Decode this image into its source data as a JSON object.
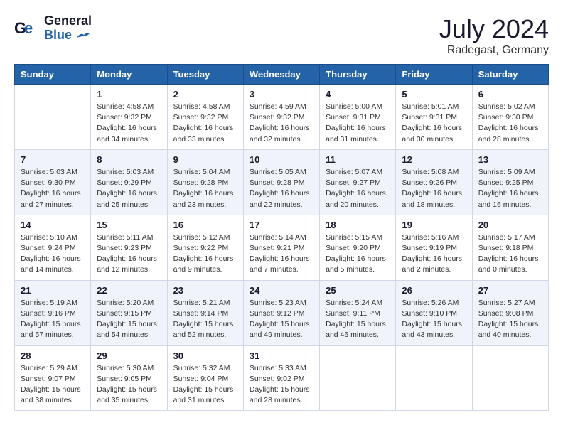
{
  "logo": {
    "general": "General",
    "blue": "Blue"
  },
  "title": "July 2024",
  "location": "Radegast, Germany",
  "days_header": [
    "Sunday",
    "Monday",
    "Tuesday",
    "Wednesday",
    "Thursday",
    "Friday",
    "Saturday"
  ],
  "weeks": [
    [
      {
        "day": "",
        "details": ""
      },
      {
        "day": "1",
        "details": "Sunrise: 4:58 AM\nSunset: 9:32 PM\nDaylight: 16 hours\nand 34 minutes."
      },
      {
        "day": "2",
        "details": "Sunrise: 4:58 AM\nSunset: 9:32 PM\nDaylight: 16 hours\nand 33 minutes."
      },
      {
        "day": "3",
        "details": "Sunrise: 4:59 AM\nSunset: 9:32 PM\nDaylight: 16 hours\nand 32 minutes."
      },
      {
        "day": "4",
        "details": "Sunrise: 5:00 AM\nSunset: 9:31 PM\nDaylight: 16 hours\nand 31 minutes."
      },
      {
        "day": "5",
        "details": "Sunrise: 5:01 AM\nSunset: 9:31 PM\nDaylight: 16 hours\nand 30 minutes."
      },
      {
        "day": "6",
        "details": "Sunrise: 5:02 AM\nSunset: 9:30 PM\nDaylight: 16 hours\nand 28 minutes."
      }
    ],
    [
      {
        "day": "7",
        "details": "Sunrise: 5:03 AM\nSunset: 9:30 PM\nDaylight: 16 hours\nand 27 minutes."
      },
      {
        "day": "8",
        "details": "Sunrise: 5:03 AM\nSunset: 9:29 PM\nDaylight: 16 hours\nand 25 minutes."
      },
      {
        "day": "9",
        "details": "Sunrise: 5:04 AM\nSunset: 9:28 PM\nDaylight: 16 hours\nand 23 minutes."
      },
      {
        "day": "10",
        "details": "Sunrise: 5:05 AM\nSunset: 9:28 PM\nDaylight: 16 hours\nand 22 minutes."
      },
      {
        "day": "11",
        "details": "Sunrise: 5:07 AM\nSunset: 9:27 PM\nDaylight: 16 hours\nand 20 minutes."
      },
      {
        "day": "12",
        "details": "Sunrise: 5:08 AM\nSunset: 9:26 PM\nDaylight: 16 hours\nand 18 minutes."
      },
      {
        "day": "13",
        "details": "Sunrise: 5:09 AM\nSunset: 9:25 PM\nDaylight: 16 hours\nand 16 minutes."
      }
    ],
    [
      {
        "day": "14",
        "details": "Sunrise: 5:10 AM\nSunset: 9:24 PM\nDaylight: 16 hours\nand 14 minutes."
      },
      {
        "day": "15",
        "details": "Sunrise: 5:11 AM\nSunset: 9:23 PM\nDaylight: 16 hours\nand 12 minutes."
      },
      {
        "day": "16",
        "details": "Sunrise: 5:12 AM\nSunset: 9:22 PM\nDaylight: 16 hours\nand 9 minutes."
      },
      {
        "day": "17",
        "details": "Sunrise: 5:14 AM\nSunset: 9:21 PM\nDaylight: 16 hours\nand 7 minutes."
      },
      {
        "day": "18",
        "details": "Sunrise: 5:15 AM\nSunset: 9:20 PM\nDaylight: 16 hours\nand 5 minutes."
      },
      {
        "day": "19",
        "details": "Sunrise: 5:16 AM\nSunset: 9:19 PM\nDaylight: 16 hours\nand 2 minutes."
      },
      {
        "day": "20",
        "details": "Sunrise: 5:17 AM\nSunset: 9:18 PM\nDaylight: 16 hours\nand 0 minutes."
      }
    ],
    [
      {
        "day": "21",
        "details": "Sunrise: 5:19 AM\nSunset: 9:16 PM\nDaylight: 15 hours\nand 57 minutes."
      },
      {
        "day": "22",
        "details": "Sunrise: 5:20 AM\nSunset: 9:15 PM\nDaylight: 15 hours\nand 54 minutes."
      },
      {
        "day": "23",
        "details": "Sunrise: 5:21 AM\nSunset: 9:14 PM\nDaylight: 15 hours\nand 52 minutes."
      },
      {
        "day": "24",
        "details": "Sunrise: 5:23 AM\nSunset: 9:12 PM\nDaylight: 15 hours\nand 49 minutes."
      },
      {
        "day": "25",
        "details": "Sunrise: 5:24 AM\nSunset: 9:11 PM\nDaylight: 15 hours\nand 46 minutes."
      },
      {
        "day": "26",
        "details": "Sunrise: 5:26 AM\nSunset: 9:10 PM\nDaylight: 15 hours\nand 43 minutes."
      },
      {
        "day": "27",
        "details": "Sunrise: 5:27 AM\nSunset: 9:08 PM\nDaylight: 15 hours\nand 40 minutes."
      }
    ],
    [
      {
        "day": "28",
        "details": "Sunrise: 5:29 AM\nSunset: 9:07 PM\nDaylight: 15 hours\nand 38 minutes."
      },
      {
        "day": "29",
        "details": "Sunrise: 5:30 AM\nSunset: 9:05 PM\nDaylight: 15 hours\nand 35 minutes."
      },
      {
        "day": "30",
        "details": "Sunrise: 5:32 AM\nSunset: 9:04 PM\nDaylight: 15 hours\nand 31 minutes."
      },
      {
        "day": "31",
        "details": "Sunrise: 5:33 AM\nSunset: 9:02 PM\nDaylight: 15 hours\nand 28 minutes."
      },
      {
        "day": "",
        "details": ""
      },
      {
        "day": "",
        "details": ""
      },
      {
        "day": "",
        "details": ""
      }
    ]
  ]
}
